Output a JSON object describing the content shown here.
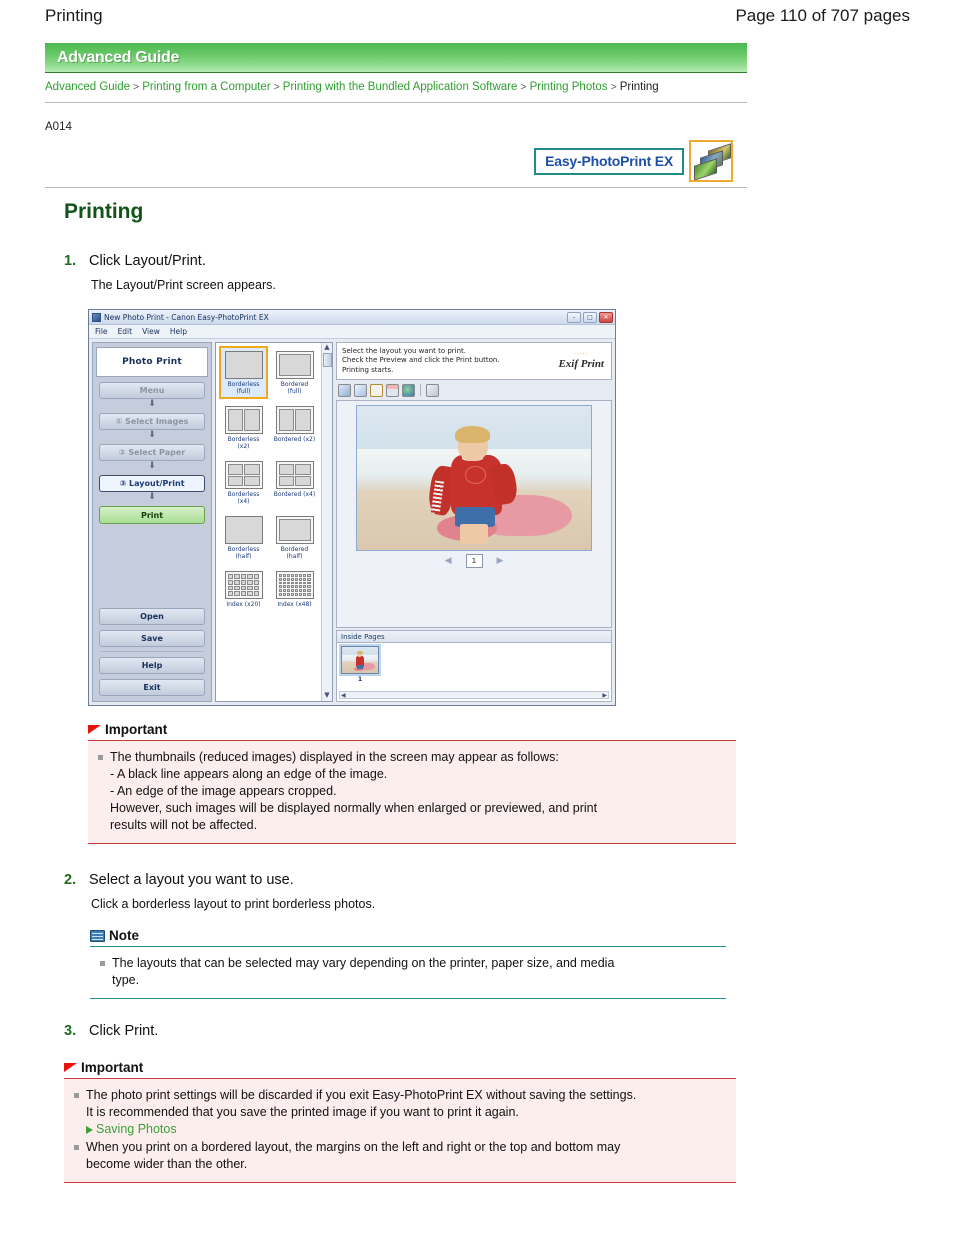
{
  "page_header": {
    "left_title": "Printing",
    "right_pagination": "Page 110 of 707 pages"
  },
  "guide": {
    "band_title": "Advanced Guide",
    "breadcrumb": [
      {
        "label": "Advanced Guide",
        "current": false
      },
      {
        "label": "Printing from a Computer",
        "current": false
      },
      {
        "label": "Printing with the Bundled Application Software",
        "current": false
      },
      {
        "label": "Printing Photos",
        "current": false
      },
      {
        "label": "Printing",
        "current": true
      }
    ],
    "separator": ">",
    "doc_id": "A014"
  },
  "product_badge": {
    "label": "Easy-PhotoPrint EX",
    "icon_name": "photo-stack-icon"
  },
  "main_heading": "Printing",
  "steps": [
    {
      "number": "1.",
      "title": "Click Layout/Print.",
      "subtitle": "The Layout/Print screen appears."
    },
    {
      "number": "2.",
      "title": "Select a layout you want to use.",
      "subtitle": "Click a borderless layout to print borderless photos."
    },
    {
      "number": "3.",
      "title": "Click Print.",
      "subtitle": ""
    }
  ],
  "app_window": {
    "title": "New Photo Print - Canon Easy-PhotoPrint EX",
    "window_buttons": {
      "minimize": "–",
      "maximize": "□",
      "close": "✕"
    },
    "menu": [
      "File",
      "Edit",
      "View",
      "Help"
    ],
    "sidebar": {
      "header": "Photo Print",
      "steps": [
        {
          "label": "Menu",
          "active": false
        },
        {
          "label": "①  Select Images",
          "active": false
        },
        {
          "label": "②  Select Paper",
          "active": false
        },
        {
          "label": "③  Layout/Print",
          "active": true
        }
      ],
      "print_button": "Print",
      "actions": [
        "Open",
        "Save",
        "Help",
        "Exit"
      ]
    },
    "info_text": [
      "Select the layout you want to print.",
      "Check the Preview and click the Print button.",
      "Printing starts."
    ],
    "exif_logo": "Exif Print",
    "toolbar_icons": [
      "rotate-left-icon",
      "rotate-right-icon",
      "crop-icon",
      "frame-icon",
      "image-enhance-icon",
      "print-settings-icon"
    ],
    "layouts": [
      {
        "label": "Borderless\n(full)",
        "cells": 1,
        "bordered": false,
        "selected": true
      },
      {
        "label": "Bordered (full)",
        "cells": 1,
        "bordered": true,
        "selected": false
      },
      {
        "label": "Borderless\n(x2)",
        "cells": 2,
        "bordered": false,
        "selected": false
      },
      {
        "label": "Bordered (x2)",
        "cells": 2,
        "bordered": true,
        "selected": false
      },
      {
        "label": "Borderless\n(x4)",
        "cells": 4,
        "bordered": false,
        "selected": false
      },
      {
        "label": "Bordered (x4)",
        "cells": 4,
        "bordered": true,
        "selected": false
      },
      {
        "label": "Borderless\n(half)",
        "cells": 1,
        "bordered": false,
        "selected": false
      },
      {
        "label": "Bordered\n(half)",
        "cells": 1,
        "bordered": true,
        "selected": false
      },
      {
        "label": "Index (x20)",
        "cells": 20,
        "bordered": false,
        "selected": false
      },
      {
        "label": "Index (x48)",
        "cells": 48,
        "bordered": false,
        "selected": false
      }
    ],
    "preview": {
      "page_number": "1",
      "prev_arrow": "◀",
      "next_arrow": "▶",
      "inside_pages_label": "Inside Pages",
      "thumbnail_number": "1"
    }
  },
  "callouts": [
    {
      "type": "important",
      "title": "Important",
      "icon": "red-flag-icon",
      "bullets": [
        {
          "lines": [
            "The thumbnails (reduced images) displayed in the screen may appear as follows:",
            "- A black line appears along an edge of the image.",
            "- An edge of the image appears cropped.",
            "However, such images will be displayed normally when enlarged or previewed, and print",
            "results will not be affected."
          ]
        }
      ]
    },
    {
      "type": "note",
      "title": "Note",
      "icon": "open-book-icon",
      "bullets": [
        {
          "lines": [
            "The layouts that can be selected may vary depending on the printer, paper size, and media",
            "type."
          ]
        }
      ]
    },
    {
      "type": "important",
      "title": "Important",
      "icon": "red-flag-icon",
      "bullets": [
        {
          "lines": [
            "The photo print settings will be discarded if you exit Easy-PhotoPrint EX without saving the settings.",
            "It is recommended that you save the printed image if you want to print it again."
          ],
          "link": "Saving Photos"
        },
        {
          "lines": [
            "When you print on a bordered layout, the margins on the left and right or the top and bottom may",
            "become wider than the other."
          ]
        }
      ]
    }
  ],
  "colors": {
    "heading_green": "#12531a",
    "link_green": "#2f9e2f",
    "important_red": "#cf3b3b",
    "note_teal": "#2a8f8f",
    "badge_teal": "#1e8a8a",
    "badge_blue": "#1c4fa8",
    "selection_orange": "#f0a81e"
  }
}
